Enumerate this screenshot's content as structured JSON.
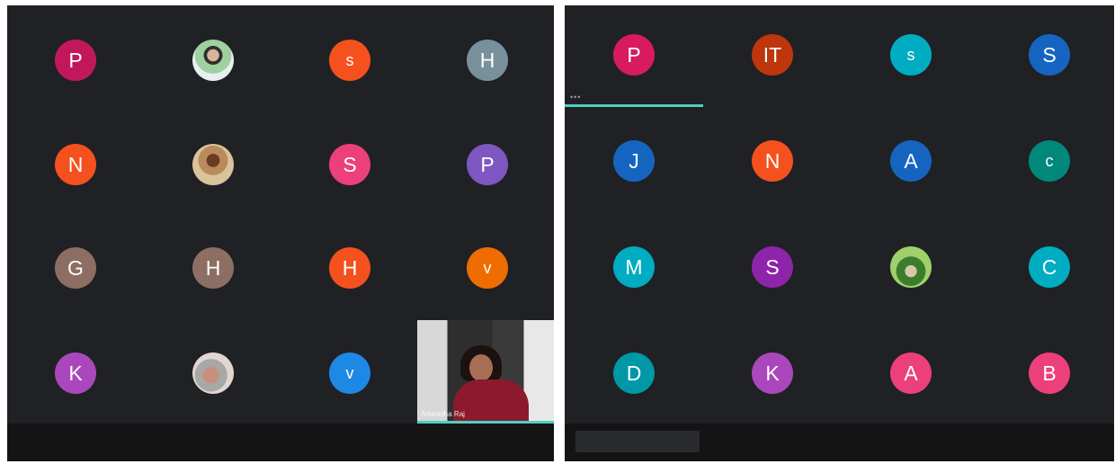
{
  "left_panel": {
    "tiles": [
      {
        "letter": "P",
        "color": "#c2185b"
      },
      {
        "photo": "photo-1",
        "icon": "participant-photo-icon"
      },
      {
        "letter": "s",
        "color": "#f4511e"
      },
      {
        "letter": "H",
        "color": "#78909c"
      },
      {
        "letter": "N",
        "color": "#f4511e"
      },
      {
        "photo": "photo-2",
        "icon": "participant-photo-icon"
      },
      {
        "letter": "S",
        "color": "#ec407a"
      },
      {
        "letter": "P",
        "color": "#7e57c2"
      },
      {
        "letter": "G",
        "color": "#8d6e63"
      },
      {
        "letter": "H",
        "color": "#8d6e63"
      },
      {
        "letter": "H",
        "color": "#f4511e"
      },
      {
        "letter": "v",
        "color": "#ef6c00"
      },
      {
        "letter": "K",
        "color": "#ab47bc"
      },
      {
        "photo": "photo-3",
        "icon": "participant-photo-icon"
      },
      {
        "letter": "v",
        "color": "#1e88e5"
      }
    ],
    "self_view": {
      "caption": "Anuradha Raj",
      "accent": "#4dd0c0"
    }
  },
  "right_panel": {
    "speaker_indicator": {
      "color": "#4dd0c0",
      "dots": "•••"
    },
    "tiles": [
      {
        "letter": "P",
        "color": "#d81b60"
      },
      {
        "letter": "IT",
        "color": "#bf360c"
      },
      {
        "letter": "s",
        "color": "#00acc1"
      },
      {
        "letter": "S",
        "color": "#1565c0"
      },
      {
        "letter": "J",
        "color": "#1565c0"
      },
      {
        "letter": "N",
        "color": "#f4511e"
      },
      {
        "letter": "A",
        "color": "#1565c0"
      },
      {
        "letter": "c",
        "color": "#00897b"
      },
      {
        "letter": "M",
        "color": "#00acc1"
      },
      {
        "letter": "S",
        "color": "#8e24aa"
      },
      {
        "photo": "photo-4",
        "icon": "participant-photo-icon"
      },
      {
        "letter": "C",
        "color": "#00acc1"
      },
      {
        "letter": "D",
        "color": "#0097a7"
      },
      {
        "letter": "K",
        "color": "#ab47bc"
      },
      {
        "letter": "A",
        "color": "#ec407a"
      },
      {
        "letter": "B",
        "color": "#ec407a"
      }
    ]
  }
}
